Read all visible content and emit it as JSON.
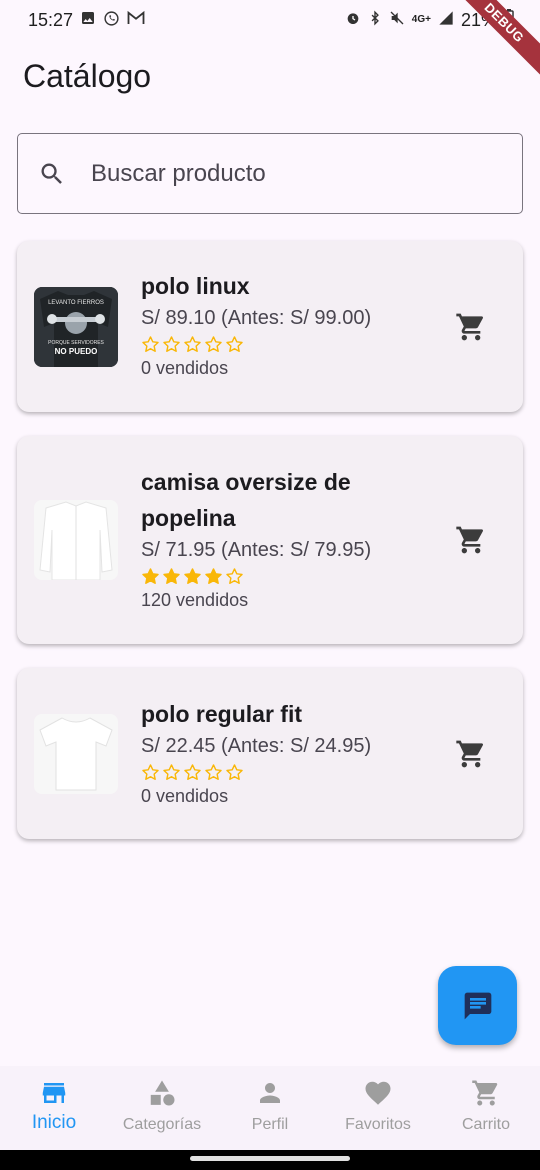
{
  "status_bar": {
    "time": "15:27",
    "battery": "21%",
    "network": "4G+",
    "left_icons": [
      "gallery-icon",
      "whatsapp-icon",
      "gmail-icon"
    ],
    "right_icons": [
      "alarm-icon",
      "bluetooth-icon",
      "mute-icon",
      "network-icon",
      "signal-icon",
      "battery-icon"
    ]
  },
  "debug_banner": "DEBUG",
  "header": {
    "title": "Catálogo"
  },
  "search": {
    "placeholder": "Buscar producto",
    "value": ""
  },
  "products": [
    {
      "name": "polo linux",
      "price": "S/ 89.10  (Antes: S/ 99.00)",
      "rating": 0,
      "max_rating": 5,
      "sold": "0 vendidos",
      "image_icon": "black-tshirt-print",
      "image_text": [
        "LEVANTO FIERROS",
        "PORQUE SERVIDORES",
        "NO PUEDO"
      ]
    },
    {
      "name": "camisa oversize de popelina",
      "price": "S/ 71.95  (Antes: S/ 79.95)",
      "rating": 4,
      "max_rating": 5,
      "sold": "120 vendidos",
      "image_icon": "white-shirt"
    },
    {
      "name": "polo regular fit",
      "price": "S/ 22.45  (Antes: S/ 24.95)",
      "rating": 0,
      "max_rating": 5,
      "sold": "0 vendidos",
      "image_icon": "white-tshirt"
    }
  ],
  "fab": {
    "icon": "chat-icon"
  },
  "bottom_nav": [
    {
      "label": "Inicio",
      "icon": "store-icon",
      "active": true
    },
    {
      "label": "Categorías",
      "icon": "category-icon",
      "active": false
    },
    {
      "label": "Perfil",
      "icon": "person-icon",
      "active": false
    },
    {
      "label": "Favoritos",
      "icon": "heart-icon",
      "active": false
    },
    {
      "label": "Carrito",
      "icon": "cart-icon",
      "active": false
    }
  ],
  "colors": {
    "accent": "#2196f3",
    "star": "#f9b708",
    "card_bg": "#f4eff4",
    "page_bg": "#fdf7fe",
    "debug": "#a5333d"
  }
}
